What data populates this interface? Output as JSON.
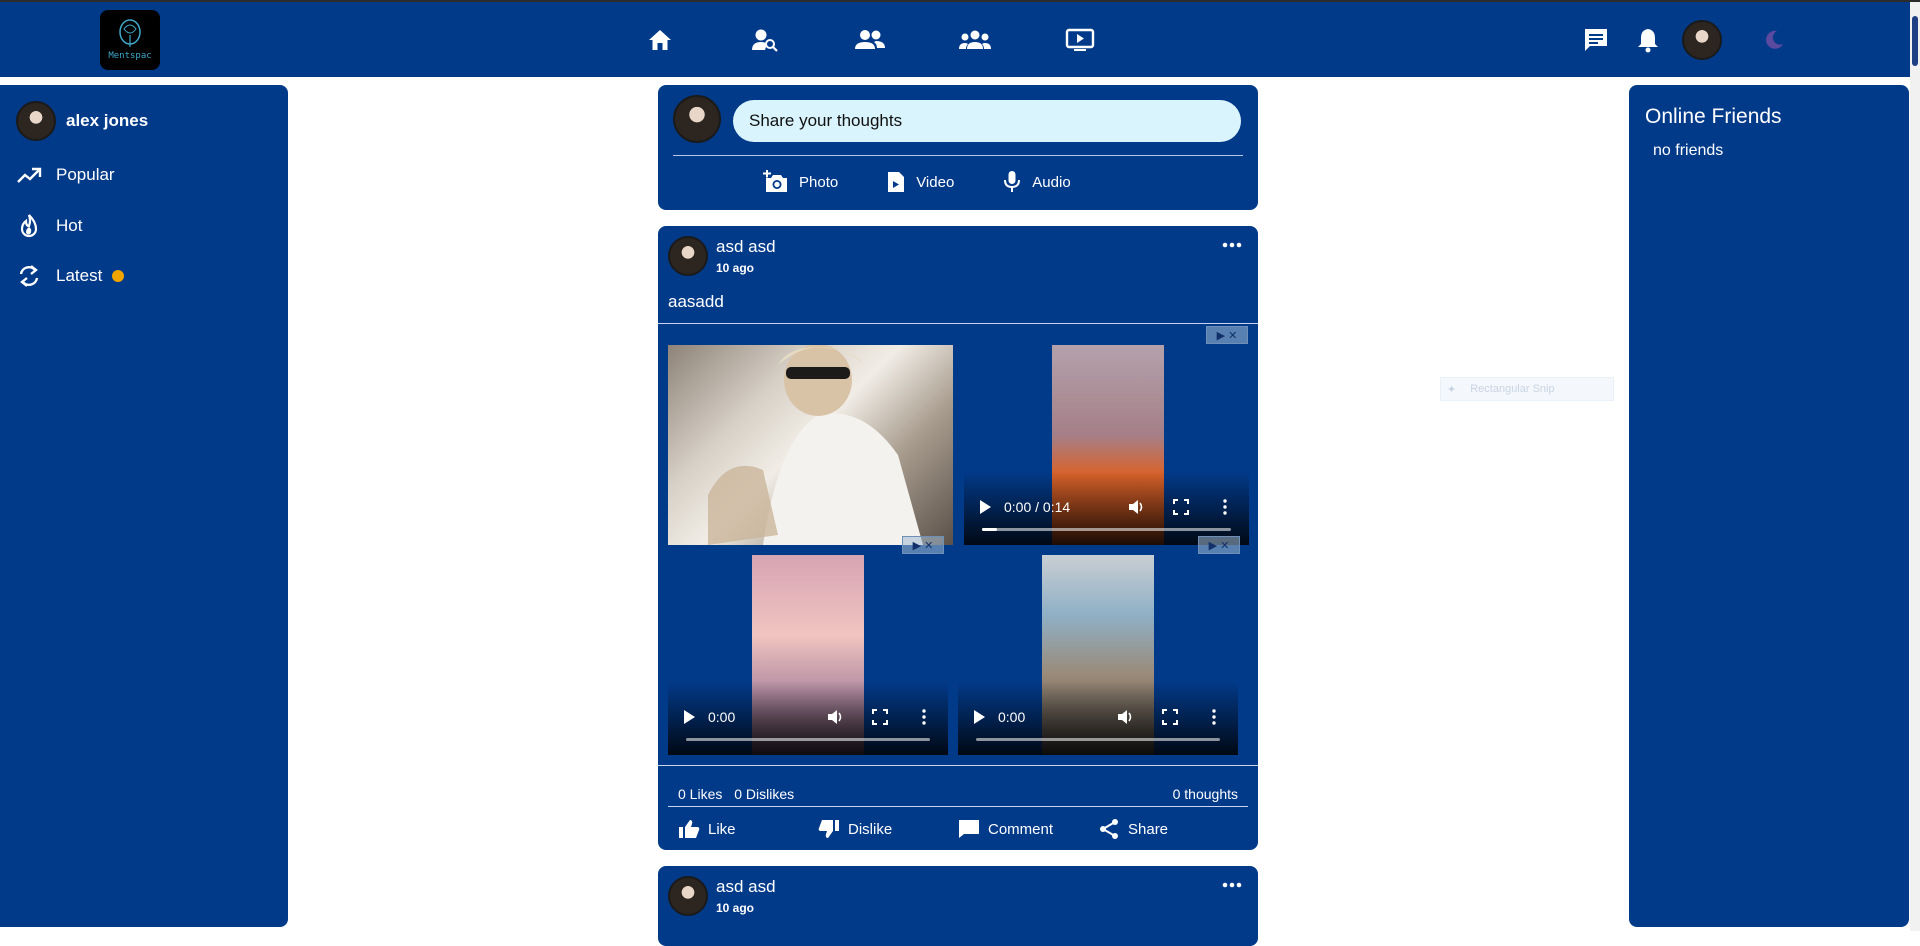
{
  "navbar": {
    "logo_text": "Mentspac",
    "icons": [
      "home-icon",
      "find-people-icon",
      "friends-icon",
      "groups-icon",
      "watch-icon"
    ],
    "right_icons": [
      "messages-icon",
      "notifications-icon",
      "profile-avatar",
      "dark-mode-icon"
    ]
  },
  "sidebar": {
    "user_name": "alex jones",
    "items": [
      {
        "label": "Popular",
        "icon": "trending-icon"
      },
      {
        "label": "Hot",
        "icon": "flame-icon"
      },
      {
        "label": "Latest",
        "icon": "refresh-icon",
        "badge_color": "#f0a500"
      }
    ]
  },
  "share": {
    "placeholder": "Share your thoughts",
    "actions": [
      {
        "label": "Photo",
        "icon": "add-photo-icon"
      },
      {
        "label": "Video",
        "icon": "video-file-icon"
      },
      {
        "label": "Audio",
        "icon": "mic-icon"
      }
    ]
  },
  "posts": [
    {
      "author": "asd asd",
      "time": "10 ago",
      "text": "aasadd",
      "videos": [
        {
          "time_label": "0:00 / 0:14",
          "progress": 0.06
        },
        {
          "time_label": "0:00",
          "progress": 0.0
        },
        {
          "time_label": "0:00",
          "progress": 0.0
        }
      ],
      "likes": "0 Likes",
      "dislikes": "0 Dislikes",
      "thoughts": "0 thoughts",
      "actions": [
        "Like",
        "Dislike",
        "Comment",
        "Share"
      ]
    },
    {
      "author": "asd asd",
      "time": "10 ago"
    }
  ],
  "online": {
    "title": "Online Friends",
    "empty": "no friends"
  },
  "ghost": {
    "label": "Rectangular Snip"
  },
  "colors": {
    "primary": "#023a8a",
    "input_bg": "#d9f4fd",
    "badge": "#f0a500",
    "dark_mode_icon": "#5b4aa0"
  }
}
